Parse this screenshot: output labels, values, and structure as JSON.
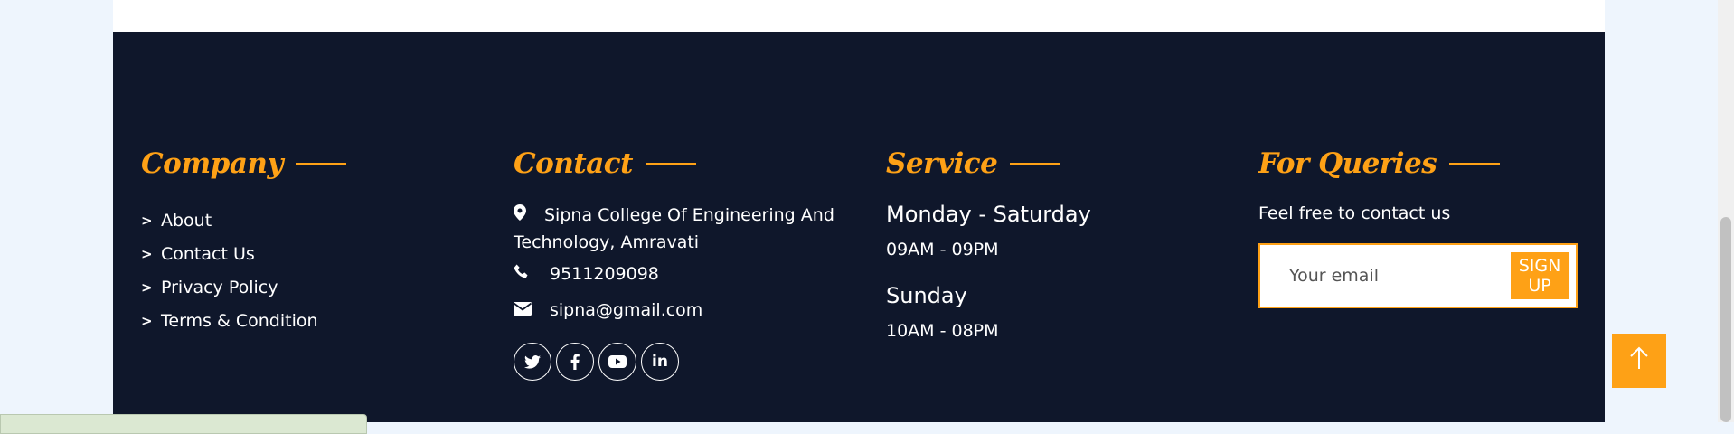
{
  "company": {
    "heading": "Company",
    "links": [
      "About",
      "Contact Us",
      "Privacy Policy",
      "Terms & Condition"
    ]
  },
  "contact": {
    "heading": "Contact",
    "address_line1": "Sipna College Of Engineering And",
    "address_line2": "Technology, Amravati",
    "phone": "9511209098",
    "email": "sipna@gmail.com",
    "socials": [
      "twitter-icon",
      "facebook-icon",
      "youtube-icon",
      "linkedin-icon"
    ]
  },
  "service": {
    "heading": "Service",
    "day1": "Monday - Saturday",
    "time1": "09AM - 09PM",
    "day2": "Sunday",
    "time2": "10AM - 08PM"
  },
  "queries": {
    "heading": "For Queries",
    "text": "Feel free to contact us",
    "email_placeholder": "Your email",
    "button": "SIGN UP"
  },
  "colors": {
    "accent": "#fea116",
    "footer_bg": "#0f172b",
    "page_bg": "#eef5fd"
  }
}
